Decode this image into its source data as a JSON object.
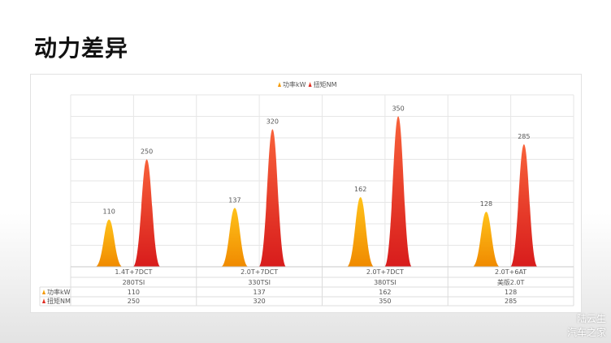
{
  "slide": {
    "title": "动力差异"
  },
  "watermark": {
    "line1": "陆云生",
    "line2": "汽车之家"
  },
  "colors": {
    "power_top": "#ffc21a",
    "power_bottom": "#f08a00",
    "torque_top": "#f8623a",
    "torque_bottom": "#d81c1c",
    "grid": "#e6e6e6",
    "text": "#555555"
  },
  "chart_data": {
    "type": "bar",
    "bar_shape": "peak",
    "legend_position": "top-center",
    "grid": true,
    "ylim": [
      0,
      400
    ],
    "categories": [
      {
        "gearbox": "1.4T+7DCT",
        "engine": "280TSI"
      },
      {
        "gearbox": "2.0T+7DCT",
        "engine": "330TSI"
      },
      {
        "gearbox": "2.0T+7DCT",
        "engine": "380TSI"
      },
      {
        "gearbox": "2.0T+6AT",
        "engine": "美版2.0T"
      }
    ],
    "series": [
      {
        "name": "功率kW",
        "color_key": "power",
        "values": [
          110,
          137,
          162,
          128
        ]
      },
      {
        "name": "扭矩NM",
        "color_key": "torque",
        "values": [
          250,
          320,
          350,
          285
        ]
      }
    ]
  }
}
